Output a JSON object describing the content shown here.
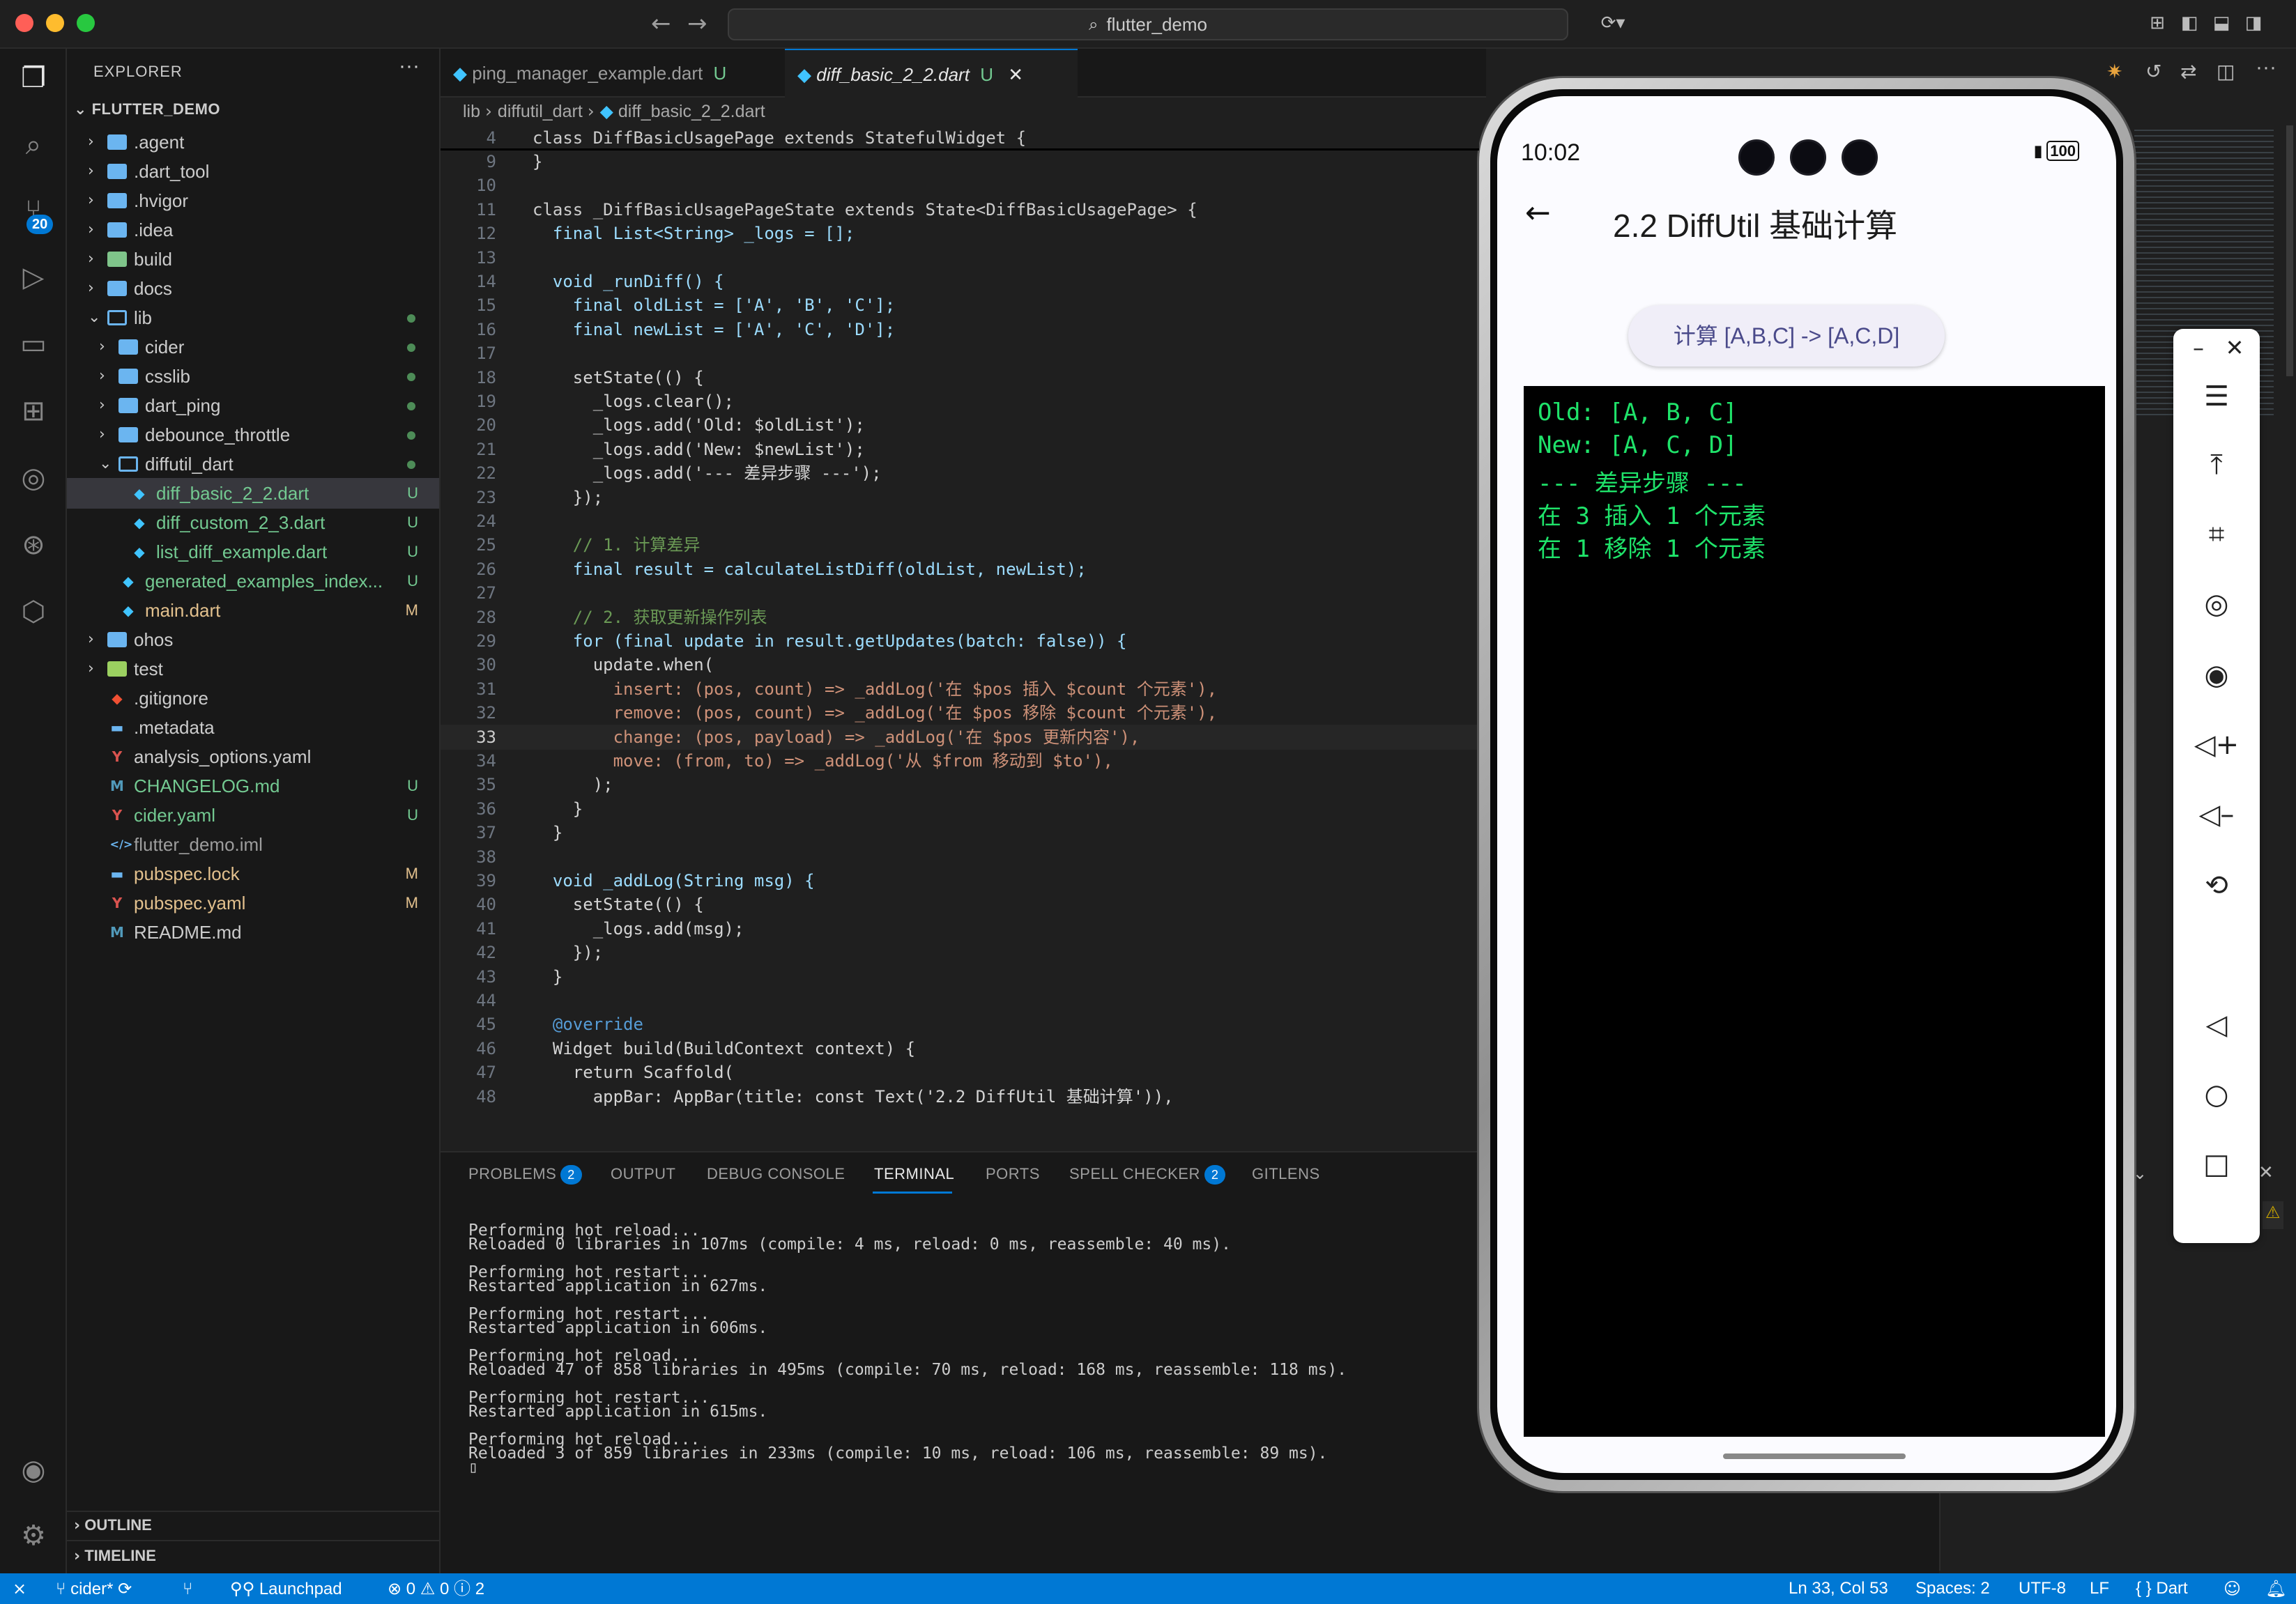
{
  "titlebar": {
    "search": "flutter_demo"
  },
  "activity": {
    "scm_badge": "20"
  },
  "sidebar": {
    "header": "EXPLORER",
    "root": "FLUTTER_DEMO",
    "items": [
      {
        "label": ".agent",
        "status": ""
      },
      {
        "label": ".dart_tool",
        "status": ""
      },
      {
        "label": ".hvigor",
        "status": ""
      },
      {
        "label": ".idea",
        "status": ""
      },
      {
        "label": "build",
        "status": ""
      },
      {
        "label": "docs",
        "status": ""
      },
      {
        "label": "lib",
        "status": ""
      },
      {
        "label": "cider",
        "status": ""
      },
      {
        "label": "csslib",
        "status": ""
      },
      {
        "label": "dart_ping",
        "status": ""
      },
      {
        "label": "debounce_throttle",
        "status": ""
      },
      {
        "label": "diffutil_dart",
        "status": ""
      },
      {
        "label": "diff_basic_2_2.dart",
        "status": "U"
      },
      {
        "label": "diff_custom_2_3.dart",
        "status": "U"
      },
      {
        "label": "list_diff_example.dart",
        "status": "U"
      },
      {
        "label": "generated_examples_index...",
        "status": "U"
      },
      {
        "label": "main.dart",
        "status": "M"
      },
      {
        "label": "ohos",
        "status": ""
      },
      {
        "label": "test",
        "status": ""
      },
      {
        "label": ".gitignore",
        "status": ""
      },
      {
        "label": ".metadata",
        "status": ""
      },
      {
        "label": "analysis_options.yaml",
        "status": ""
      },
      {
        "label": "CHANGELOG.md",
        "status": "U"
      },
      {
        "label": "cider.yaml",
        "status": "U"
      },
      {
        "label": "flutter_demo.iml",
        "status": ""
      },
      {
        "label": "pubspec.lock",
        "status": "M"
      },
      {
        "label": "pubspec.yaml",
        "status": "M"
      },
      {
        "label": "README.md",
        "status": ""
      }
    ],
    "outline": "OUTLINE",
    "timeline": "TIMELINE"
  },
  "tabs": [
    {
      "label": "ping_manager_example.dart",
      "status": "U"
    },
    {
      "label": "diff_basic_2_2.dart",
      "status": "U"
    }
  ],
  "breadcrumb": {
    "a": "lib",
    "b": "diffutil_dart",
    "c": "diff_basic_2_2.dart"
  },
  "code": {
    "l4n": "4",
    "l9n": "9",
    "l10n": "10",
    "l11n": "11",
    "l12n": "12",
    "l13n": "13",
    "l14n": "14",
    "l15n": "15",
    "l16n": "16",
    "l17n": "17",
    "l18n": "18",
    "l19n": "19",
    "l20n": "20",
    "l21n": "21",
    "l22n": "22",
    "l23n": "23",
    "l24n": "24",
    "l25n": "25",
    "l26n": "26",
    "l27n": "27",
    "l28n": "28",
    "l29n": "29",
    "l30n": "30",
    "l31n": "31",
    "l32n": "32",
    "l33n": "33",
    "l34n": "34",
    "l35n": "35",
    "l36n": "36",
    "l37n": "37",
    "l38n": "38",
    "l39n": "39",
    "l40n": "40",
    "l41n": "41",
    "l42n": "42",
    "l43n": "43",
    "l44n": "44",
    "l45n": "45",
    "l46n": "46",
    "l47n": "47",
    "l48n": "48",
    "l4": "class DiffBasicUsagePage extends StatefulWidget {",
    "l9": "}",
    "l11": "class _DiffBasicUsagePageState extends State<DiffBasicUsagePage> {",
    "l12": "  final List<String> _logs = [];",
    "l14": "  void _runDiff() {",
    "l15": "    final oldList = ['A', 'B', 'C'];",
    "l16": "    final newList = ['A', 'C', 'D'];",
    "l18": "    setState(() {",
    "l19": "      _logs.clear();",
    "l20": "      _logs.add('Old: $oldList');",
    "l21": "      _logs.add('New: $newList');",
    "l22": "      _logs.add('--- 差异步骤 ---');",
    "l23": "    });",
    "l25": "    // 1. 计算差异",
    "l26": "    final result = calculateListDiff(oldList, newList);",
    "l28": "    // 2. 获取更新操作列表",
    "l29": "    for (final update in result.getUpdates(batch: false)) {",
    "l30": "      update.when(",
    "l31": "        insert: (pos, count) => _addLog('在 $pos 插入 $count 个元素'),",
    "l32": "        remove: (pos, count) => _addLog('在 $pos 移除 $count 个元素'),",
    "l33": "        change: (pos, payload) => _addLog('在 $pos 更新内容'),",
    "l34": "        move: (from, to) => _addLog('从 $from 移动到 $to'),",
    "l35": "      );",
    "l36": "    }",
    "l37": "  }",
    "l39": "  void _addLog(String msg) {",
    "l40": "    setState(() {",
    "l41": "      _logs.add(msg);",
    "l42": "    });",
    "l43": "  }",
    "l45": "  @override",
    "l46": "  Widget build(BuildContext context) {",
    "l47": "    return Scaffold(",
    "l48": "      appBar: AppBar(title: const Text('2.2 DiffUtil 基础计算')),"
  },
  "panel": {
    "tabs": [
      "PROBLEMS",
      "OUTPUT",
      "DEBUG CONSOLE",
      "TERMINAL",
      "PORTS",
      "SPELL CHECKER",
      "GITLENS"
    ],
    "problems_badge": "2",
    "spell_badge": "2",
    "terminal": [
      "Performing hot reload...",
      "Reloaded 0 libraries in 107ms (compile: 4 ms, reload: 0 ms, reassemble: 40 ms).",
      "",
      "Performing hot restart...",
      "Restarted application in 627ms.",
      "",
      "Performing hot restart...",
      "Restarted application in 606ms.",
      "",
      "Performing hot reload...",
      "Reloaded 47 of 858 libraries in 495ms (compile: 70 ms, reload: 168 ms, reassemble: 118 ms).",
      "",
      "Performing hot restart...",
      "Restarted application in 615ms.",
      "",
      "Performing hot reload...",
      "Reloaded 3 of 859 libraries in 233ms (compile: 10 ms, reload: 106 ms, reassemble: 89 ms).",
      "▯"
    ]
  },
  "status": {
    "branch": "cider*",
    "launchpad": "Launchpad",
    "errors": "0",
    "warnings": "0",
    "infos": "2",
    "position": "Ln 33, Col 53",
    "spaces": "Spaces: 2",
    "encoding": "UTF-8",
    "eol": "LF",
    "language": "Dart"
  },
  "phone": {
    "time": "10:02",
    "battery": "100",
    "title": "2.2 DiffUtil 基础计算",
    "button": "计算 [A,B,C] -> [A,C,D]",
    "console": [
      "Old: [A, B, C]",
      "New: [A, C, D]",
      "--- 差异步骤 ---",
      "在 3 插入 1 个元素",
      "在 1 移除 1 个元素"
    ]
  },
  "colors": {
    "accent": "#0078d4",
    "console_text": "#1fe36a",
    "folder": "#6bb5f0",
    "untracked": "#73c991",
    "modified": "#e2c08d"
  }
}
